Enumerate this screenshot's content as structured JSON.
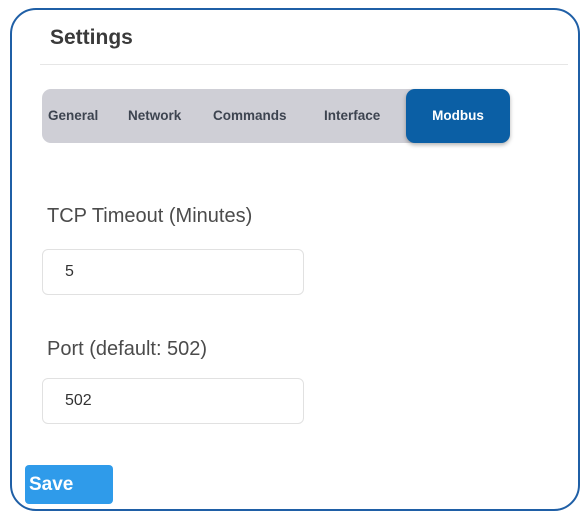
{
  "header": {
    "title": "Settings"
  },
  "tabs": [
    {
      "label": "General",
      "active": false
    },
    {
      "label": "Network",
      "active": false
    },
    {
      "label": "Commands",
      "active": false
    },
    {
      "label": "Interface",
      "active": false
    },
    {
      "label": "Modbus",
      "active": true
    }
  ],
  "form": {
    "tcp_timeout": {
      "label": "TCP Timeout (Minutes)",
      "value": "5"
    },
    "port": {
      "label": "Port (default: 502)",
      "value": "502"
    }
  },
  "actions": {
    "save_label": "Save"
  },
  "colors": {
    "card_border": "#1f5fa6",
    "tab_bar_bg": "#cfcfd6",
    "active_tab_bg": "#0b5fa5",
    "save_button_bg": "#2f9bea"
  }
}
